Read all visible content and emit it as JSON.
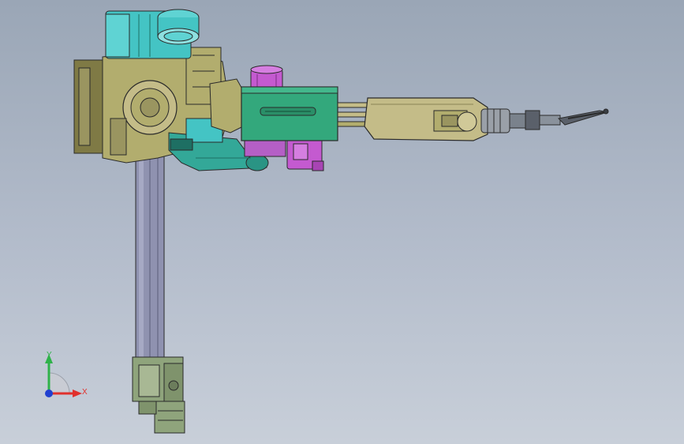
{
  "viewport": {
    "background_top": "#9aa6b6",
    "background_bottom": "#c8cfd9"
  },
  "model": {
    "colors": {
      "olive": "#b2ad6e",
      "olive_dark": "#7f7a45",
      "cyan": "#44c4c4",
      "teal": "#33a898",
      "teal_dark": "#1e6f63",
      "magenta": "#c45ad0",
      "column": "#8f92b0",
      "tan": "#c4bc88",
      "green_gray": "#8fa47c",
      "outline": "#2a2a2a"
    }
  },
  "triad": {
    "y_label": "Y",
    "x_label": "X",
    "y_color": "#2fb24a",
    "x_color": "#e0302c",
    "z_color": "#2040d0"
  }
}
